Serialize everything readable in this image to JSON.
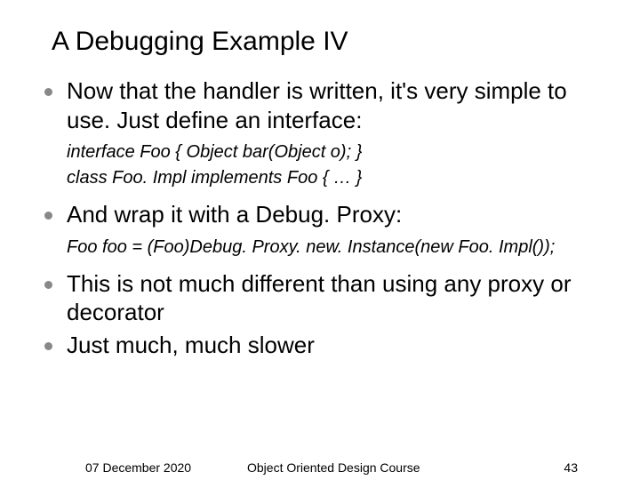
{
  "title": "A Debugging Example IV",
  "bullets": [
    {
      "text": "Now that the handler is written, it's very simple to use. Just define an interface:",
      "code": [
        "interface Foo { Object bar(Object o); }",
        "class Foo. Impl implements Foo { … }"
      ]
    },
    {
      "text": "And wrap it with a Debug. Proxy:",
      "code": [
        "Foo foo = (Foo)Debug. Proxy. new. Instance(new Foo. Impl());"
      ]
    },
    {
      "text": "This is not much different than using any proxy or decorator",
      "code": []
    },
    {
      "text": "Just much, much slower",
      "code": []
    }
  ],
  "footer": {
    "date": "07 December 2020",
    "course": "Object Oriented Design Course",
    "page": "43"
  }
}
